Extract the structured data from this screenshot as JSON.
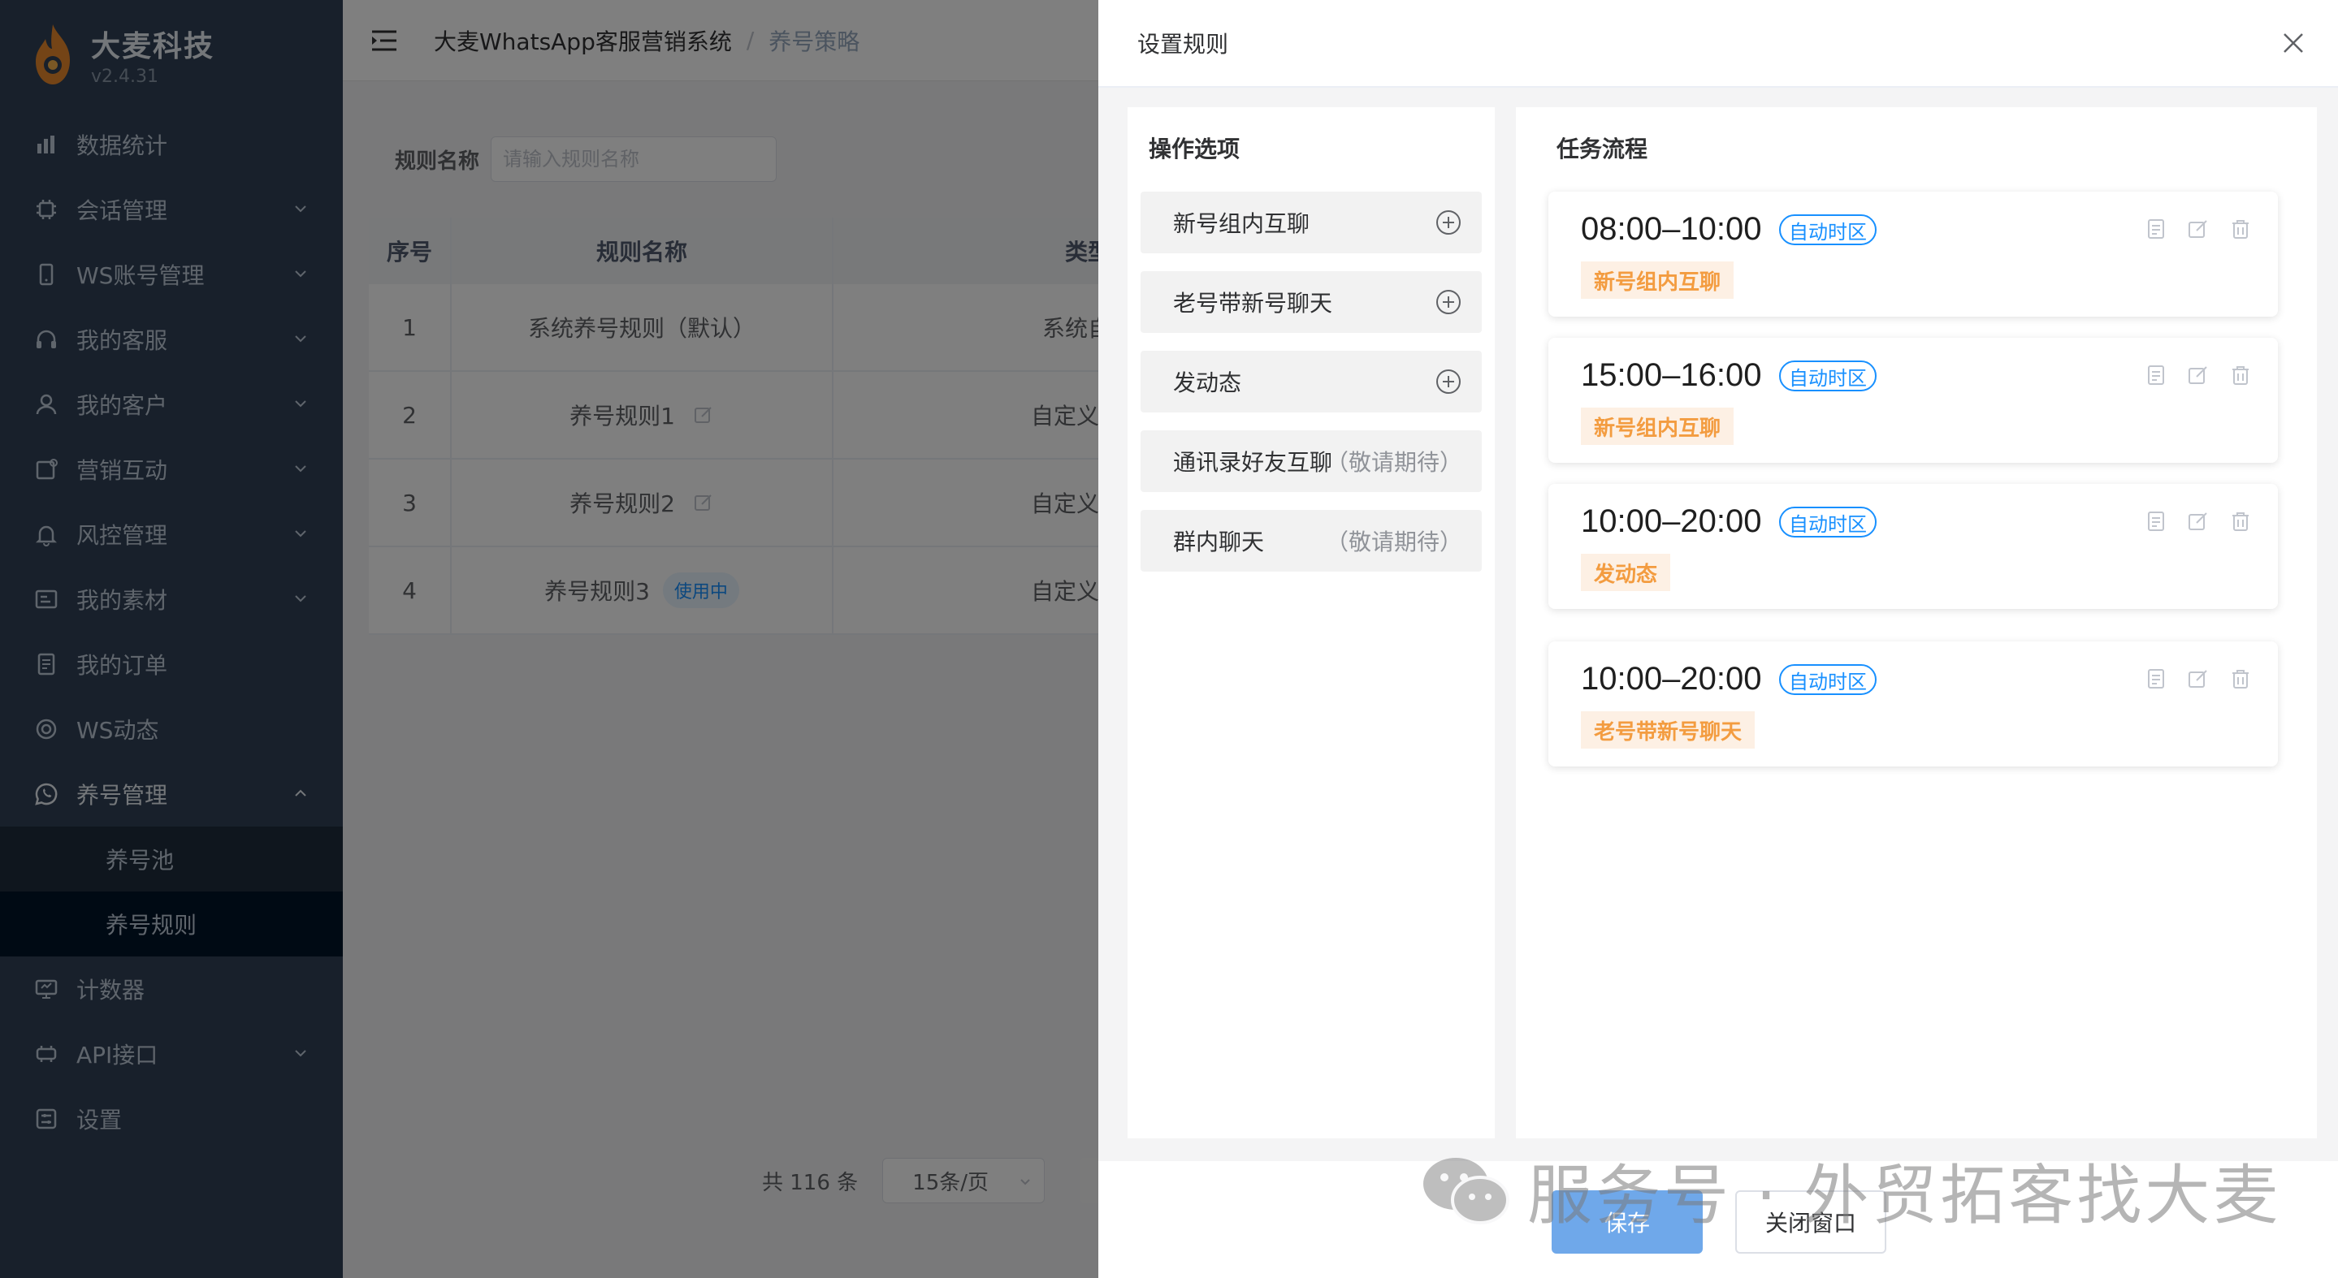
{
  "brand": {
    "name": "大麦科技",
    "version": "v2.4.31"
  },
  "menu": {
    "items": [
      {
        "label": "数据统计",
        "icon": "bar-chart-icon",
        "expandable": false
      },
      {
        "label": "会话管理",
        "icon": "chip-icon",
        "expandable": true
      },
      {
        "label": "WS账号管理",
        "icon": "phone-icon",
        "expandable": true
      },
      {
        "label": "我的客服",
        "icon": "headset-icon",
        "expandable": true
      },
      {
        "label": "我的客户",
        "icon": "user-icon",
        "expandable": true
      },
      {
        "label": "营销互动",
        "icon": "marketing-icon",
        "expandable": true
      },
      {
        "label": "风控管理",
        "icon": "bell-icon",
        "expandable": true
      },
      {
        "label": "我的素材",
        "icon": "material-icon",
        "expandable": true
      },
      {
        "label": "我的订单",
        "icon": "document-icon",
        "expandable": false
      },
      {
        "label": "WS动态",
        "icon": "circle-icon",
        "expandable": false
      }
    ],
    "open_group": {
      "label": "养号管理",
      "icon": "whatsapp-icon",
      "children": [
        "养号池",
        "养号规则"
      ],
      "active_child": "养号规则"
    },
    "after": [
      {
        "label": "计数器",
        "icon": "counter-icon",
        "expandable": false
      },
      {
        "label": "API接口",
        "icon": "api-icon",
        "expandable": true
      },
      {
        "label": "设置",
        "icon": "settings-icon",
        "expandable": false
      }
    ]
  },
  "header": {
    "system": "大麦WhatsApp客服营销系统",
    "sep": "/",
    "current": "养号策略"
  },
  "filter": {
    "label": "规则名称",
    "placeholder": "请输入规则名称"
  },
  "table": {
    "headers": [
      "序号",
      "规则名称",
      "类型"
    ],
    "rows": [
      {
        "no": "1",
        "name": "系统养号规则（默认）",
        "type": "系统自带",
        "editable": false,
        "badge": ""
      },
      {
        "no": "2",
        "name": "养号规则1",
        "type": "自定义创建",
        "editable": true,
        "badge": ""
      },
      {
        "no": "3",
        "name": "养号规则2",
        "type": "自定义创建",
        "editable": true,
        "badge": ""
      },
      {
        "no": "4",
        "name": "养号规则3",
        "type": "自定义创建",
        "editable": false,
        "badge": "使用中"
      }
    ]
  },
  "pagination": {
    "total": "共 116 条",
    "page_size": "15条/页"
  },
  "drawer": {
    "title": "设置规则",
    "options_title": "操作选项",
    "options": [
      {
        "label": "新号组内互聊",
        "available": true,
        "note": ""
      },
      {
        "label": "老号带新号聊天",
        "available": true,
        "note": ""
      },
      {
        "label": "发动态",
        "available": true,
        "note": ""
      },
      {
        "label": "通讯录好友互聊",
        "available": false,
        "note": "（敬请期待）"
      },
      {
        "label": "群内聊天",
        "available": false,
        "note": "（敬请期待）"
      }
    ],
    "flow_title": "任务流程",
    "tasks": [
      {
        "time": "08:00–10:00",
        "tz": "自动时区",
        "task": "新号组内互聊"
      },
      {
        "time": "15:00–16:00",
        "tz": "自动时区",
        "task": "新号组内互聊"
      },
      {
        "time": "10:00–20:00",
        "tz": "自动时区",
        "task": "发动态"
      },
      {
        "time": "10:00–20:00",
        "tz": "自动时区",
        "task": "老号带新号聊天"
      }
    ],
    "save_label": "保存",
    "close_label": "关闭窗口"
  },
  "watermark": {
    "text": "服务号 · 外贸拓客找大麦"
  },
  "colors": {
    "sidebar": "#304156",
    "accent": "#1890ff",
    "task_tag": "#f39c40",
    "save_button": "#6fa8ea"
  }
}
